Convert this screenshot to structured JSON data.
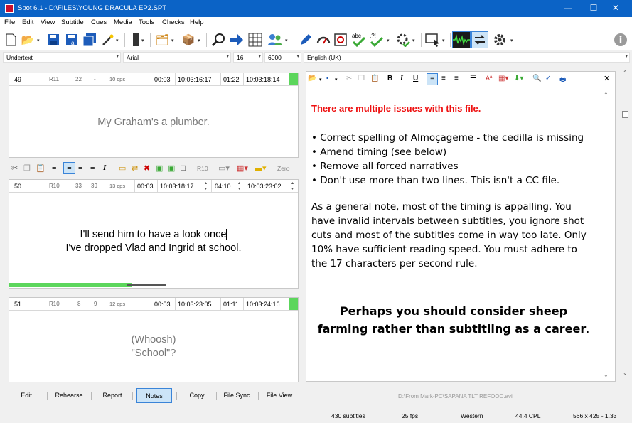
{
  "window": {
    "title": "Spot 6.1 - D:\\FILES\\YOUNG DRACULA EP2.SPT",
    "minimize": "—",
    "maximize": "☐",
    "close": "✕"
  },
  "menu": [
    "File",
    "Edit",
    "View",
    "Subtitle",
    "Cues",
    "Media",
    "Tools",
    "Checks",
    "Help"
  ],
  "format_bar": {
    "style": "Undertext",
    "font": "Arial",
    "size": "16",
    "value": "6000",
    "language": "English (UK)"
  },
  "subtitles": [
    {
      "number": "49",
      "region": "R11",
      "chars": "22",
      "max": "-",
      "cps": "10 cps",
      "duration": "00:03",
      "in": "10:03:16:17",
      "gap": "01:22",
      "out": "10:03:18:14",
      "lines": [
        "My Graham's a plumber."
      ]
    },
    {
      "number": "50",
      "region": "R10",
      "chars": "33",
      "max": "39",
      "cps": "13 cps",
      "duration": "00:03",
      "in": "10:03:18:17",
      "gap": "04:10",
      "out": "10:03:23:02",
      "lines": [
        "I'll send him to have a look once",
        "I've dropped Vlad and Ingrid at school."
      ]
    },
    {
      "number": "51",
      "region": "R10",
      "chars": "8",
      "max": "9",
      "cps": "12 cps",
      "duration": "00:03",
      "in": "10:03:23:05",
      "gap": "01:11",
      "out": "10:03:24:16",
      "lines": [
        "(Whoosh)",
        "\"School\"?"
      ]
    }
  ],
  "edit_toolbar": {
    "region": "R10",
    "zero": "Zero"
  },
  "notes": {
    "heading": "There are multiple issues with this file.",
    "bullets": [
      "Correct spelling of Almoçageme - the cedilla is missing",
      "Amend timing (see below)",
      "Remove all forced narratives",
      "Don't use more than two lines. This isn't a CC file."
    ],
    "paragraph": "As a general note, most of the timing is appalling. You have invalid intervals between subtitles, you ignore shot cuts and most of the subtitles come in way too late. Only 10% have sufficient reading speed. You must adhere to the 17 characters per second rule.",
    "closing_bold": "Perhaps you should consider sheep farming rather than subtitling as a career",
    "closing_end": "."
  },
  "bottom_buttons": [
    "Edit",
    "Rehearse",
    "Report",
    "Notes",
    "Copy",
    "File Sync",
    "File View"
  ],
  "video_path": "D:\\From Mark-PC\\SAPANA TLT REFOOD.avi",
  "status": {
    "subtitles": "430 subtitles",
    "fps": "25 fps",
    "charset": "Western",
    "cpl": "44.4 CPL",
    "resolution": "566 x 425 - 1.33"
  },
  "colors": {
    "titlebar": "#0b63c6",
    "heading_red": "#ee1111",
    "timing_green": "#5cd65c",
    "notes_selected": "#cce4f7"
  }
}
